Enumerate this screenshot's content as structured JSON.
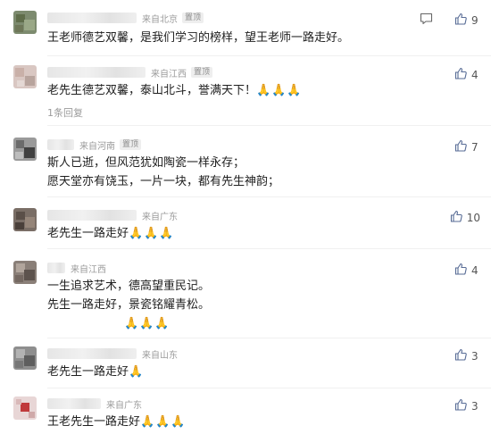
{
  "comments": [
    {
      "location": "来自北京",
      "badge": "置顶",
      "lines": [
        "王老师德艺双馨，是我们学习的榜样，望王老师一路走好。"
      ],
      "likes": "9",
      "has_reply_icon": true
    },
    {
      "location": "来自江西",
      "badge": "置顶",
      "lines": [
        "老先生德艺双馨，泰山北斗，誉满天下！"
      ],
      "emoji": "🙏🙏🙏",
      "reply_link": "1条回复",
      "likes": "4"
    },
    {
      "location": "来自河南",
      "badge": "置顶",
      "lines": [
        "斯人已逝，但风范犹如陶瓷一样永存；",
        "愿天堂亦有饶玉，一片一块，都有先生神韵；"
      ],
      "likes": "7"
    },
    {
      "location": "来自广东",
      "lines": [
        "老先生一路走好"
      ],
      "emoji": "🙏🙏🙏",
      "likes": "10"
    },
    {
      "location": "来自江西",
      "lines": [
        "一生追求艺术，德高望重民记。",
        "先生一路走好，景瓷铭耀青松。"
      ],
      "emoji": "🙏🙏🙏",
      "likes": "4"
    },
    {
      "location": "来自山东",
      "lines": [
        "老先生一路走好"
      ],
      "emoji": "🙏",
      "likes": "3"
    },
    {
      "location": "来自广东",
      "lines": [
        "王老先生一路走好"
      ],
      "emoji": "🙏🙏🙏",
      "likes": "3"
    }
  ],
  "colors": {
    "meta": "#9b9b9b",
    "badge_bg": "#eeeeee",
    "text": "#1f1f1f"
  }
}
